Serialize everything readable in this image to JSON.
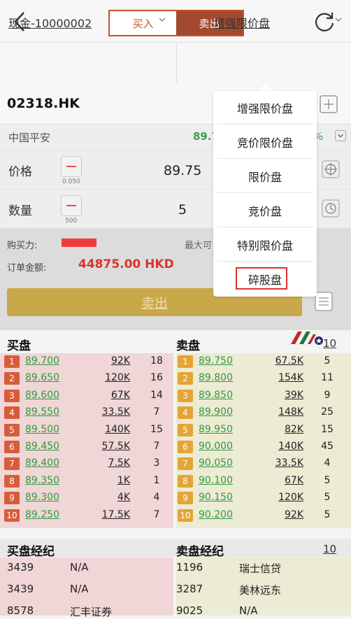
{
  "header": {
    "tabs": [
      "买入",
      "卖出"
    ],
    "active_tab": "卖出"
  },
  "account": {
    "label": "现金-10000002",
    "order_type": "增强限价盘"
  },
  "stock": {
    "code": "02318.HK",
    "name": "中国平安",
    "price_partial": "89.7",
    "change_partial": "%"
  },
  "order": {
    "price_label": "价格",
    "price_value": "89.75",
    "price_step": "0.050",
    "qty_label": "数量",
    "qty_value": "5",
    "qty_step": "500"
  },
  "summary": {
    "buying_power_label": "购买力:",
    "max_label": "最大可",
    "amount_label": "订单金额:",
    "amount_value": "44875.00 HKD"
  },
  "sell_button": "卖出",
  "dropdown": {
    "items": [
      "增强限价盘",
      "竞价限价盘",
      "限价盘",
      "竞价盘",
      "特别限价盘",
      "碎股盘"
    ],
    "highlighted": "碎股盘"
  },
  "order_book": {
    "bid_title": "买盘",
    "ask_title": "卖盘",
    "page_label": "10",
    "bids": [
      {
        "rank": "1",
        "price": "89.700",
        "volume": "92K",
        "count": "18"
      },
      {
        "rank": "2",
        "price": "89.650",
        "volume": "120K",
        "count": "16"
      },
      {
        "rank": "3",
        "price": "89.600",
        "volume": "67K",
        "count": "14"
      },
      {
        "rank": "4",
        "price": "89.550",
        "volume": "33.5K",
        "count": "7"
      },
      {
        "rank": "5",
        "price": "89.500",
        "volume": "140K",
        "count": "15"
      },
      {
        "rank": "6",
        "price": "89.450",
        "volume": "57.5K",
        "count": "7"
      },
      {
        "rank": "7",
        "price": "89.400",
        "volume": "7.5K",
        "count": "3"
      },
      {
        "rank": "8",
        "price": "89.350",
        "volume": "1K",
        "count": "1"
      },
      {
        "rank": "9",
        "price": "89.300",
        "volume": "4K",
        "count": "4"
      },
      {
        "rank": "10",
        "price": "89.250",
        "volume": "17.5K",
        "count": "7"
      }
    ],
    "asks": [
      {
        "rank": "1",
        "price": "89.750",
        "volume": "67.5K",
        "count": "5"
      },
      {
        "rank": "2",
        "price": "89.800",
        "volume": "154K",
        "count": "11"
      },
      {
        "rank": "3",
        "price": "89.850",
        "volume": "39K",
        "count": "9"
      },
      {
        "rank": "4",
        "price": "89.900",
        "volume": "148K",
        "count": "25"
      },
      {
        "rank": "5",
        "price": "89.950",
        "volume": "82K",
        "count": "15"
      },
      {
        "rank": "6",
        "price": "90.000",
        "volume": "140K",
        "count": "45"
      },
      {
        "rank": "7",
        "price": "90.050",
        "volume": "33.5K",
        "count": "4"
      },
      {
        "rank": "8",
        "price": "90.100",
        "volume": "67K",
        "count": "5"
      },
      {
        "rank": "9",
        "price": "90.150",
        "volume": "120K",
        "count": "5"
      },
      {
        "rank": "10",
        "price": "90.200",
        "volume": "92K",
        "count": "5"
      }
    ]
  },
  "brokers": {
    "buy_title": "买盘经纪",
    "sell_title": "卖盘经纪",
    "page_label": "10",
    "buy": [
      {
        "id": "3439",
        "name": "N/A"
      },
      {
        "id": "3439",
        "name": "N/A"
      },
      {
        "id": "8578",
        "name": "汇丰证券"
      }
    ],
    "sell": [
      {
        "id": "1196",
        "name": "瑞士信贷"
      },
      {
        "id": "3287",
        "name": "美林远东"
      },
      {
        "id": "9025",
        "name": "N/A"
      }
    ]
  },
  "colors": {
    "accent": "#c8502c",
    "sell_tab": "#a24a2f",
    "gold_button": "#c9a84a",
    "up_green": "#2e9a3f",
    "amount_red": "#d9342b"
  }
}
